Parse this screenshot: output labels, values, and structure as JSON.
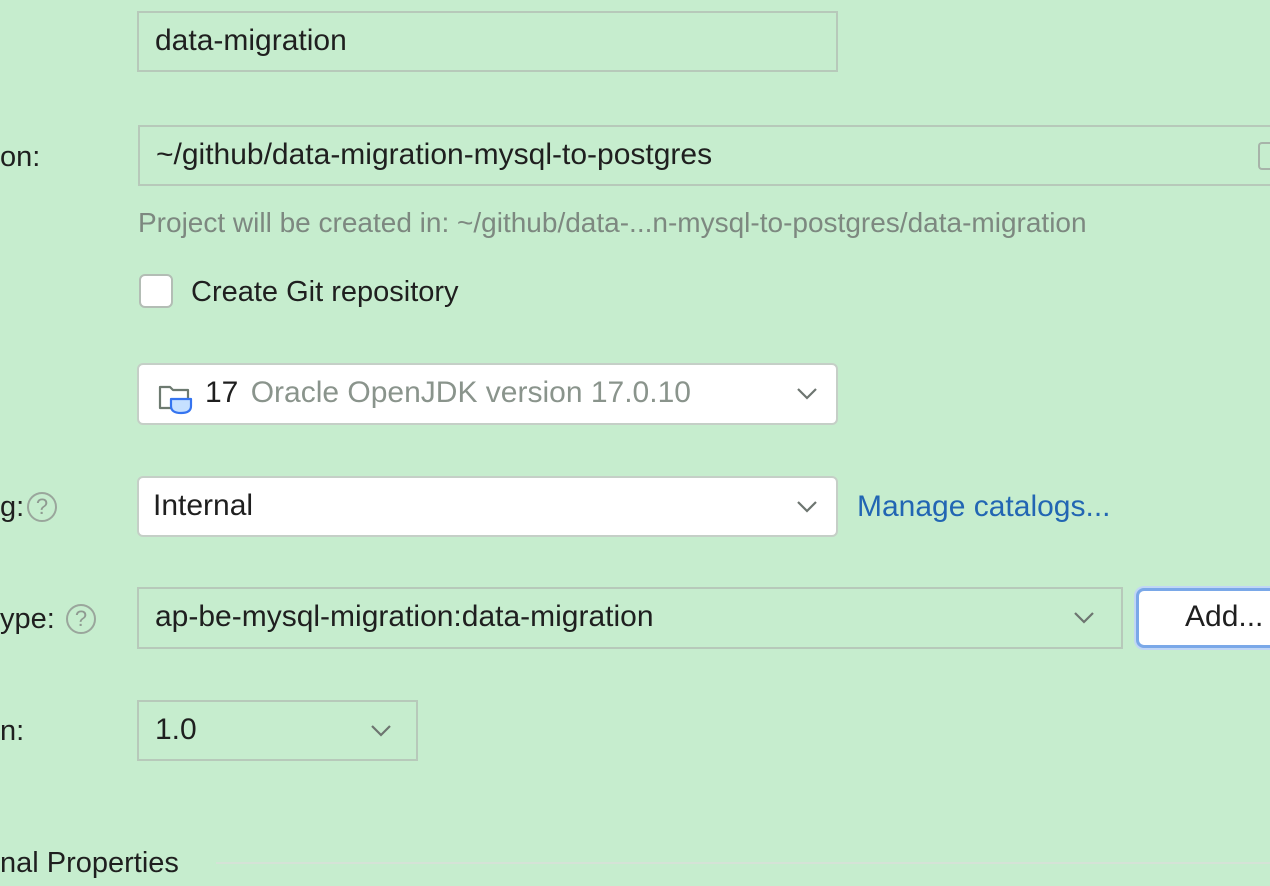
{
  "form": {
    "name": {
      "value": "data-migration"
    },
    "location": {
      "label": "on:",
      "value": "~/github/data-migration-mysql-to-postgres",
      "hint": "Project will be created in: ~/github/data-...n-mysql-to-postgres/data-migration"
    },
    "git": {
      "label": "Create Git repository",
      "checked": false
    },
    "jdk": {
      "version": "17",
      "description": "Oracle OpenJDK version 17.0.10"
    },
    "catalog": {
      "label": "g:",
      "value": "Internal",
      "manage_link": "Manage catalogs..."
    },
    "archetype": {
      "label": "ype:",
      "value": "ap-be-mysql-migration:data-migration",
      "add_button": "Add..."
    },
    "version": {
      "label": "n:",
      "value": "1.0"
    },
    "additional": {
      "label": "nal Properties"
    }
  },
  "icons": {
    "help": "?",
    "jdk_icon": "folder-cup-icon",
    "chevron": "chevron-down-icon",
    "browse": "folder-icon"
  },
  "colors": {
    "background": "#c6edce",
    "link": "#2266b3",
    "focus_ring": "#7aa8e8"
  }
}
